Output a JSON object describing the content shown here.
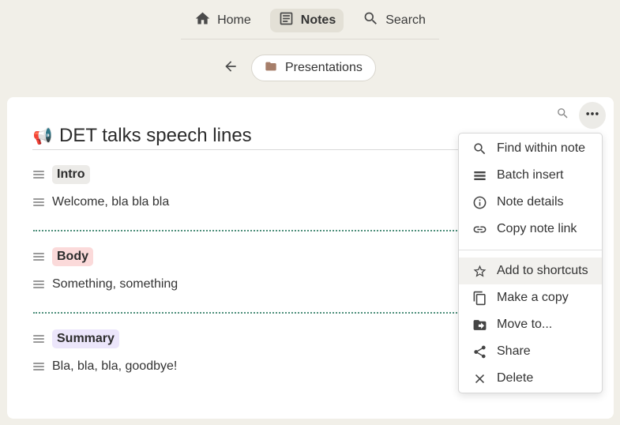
{
  "nav": {
    "home_label": "Home",
    "notes_label": "Notes",
    "search_label": "Search"
  },
  "breadcrumb": {
    "folder_label": "Presentations"
  },
  "note": {
    "title_emoji": "📢",
    "title": "DET talks speech lines",
    "sections": [
      {
        "tag": "Intro",
        "text": "Welcome, bla bla bla"
      },
      {
        "tag": "Body",
        "text": "Something, something"
      },
      {
        "tag": "Summary",
        "text": "Bla, bla, bla, goodbye!"
      }
    ]
  },
  "menu": {
    "items": [
      {
        "label": "Find within note",
        "icon": "search-icon"
      },
      {
        "label": "Batch insert",
        "icon": "batch-insert-icon"
      },
      {
        "label": "Note details",
        "icon": "info-icon"
      },
      {
        "label": "Copy note link",
        "icon": "link-icon"
      },
      {
        "label": "Add to shortcuts",
        "icon": "star-icon"
      },
      {
        "label": "Make a copy",
        "icon": "copy-icon"
      },
      {
        "label": "Move to...",
        "icon": "move-folder-icon"
      },
      {
        "label": "Share",
        "icon": "share-icon"
      },
      {
        "label": "Delete",
        "icon": "close-icon"
      }
    ]
  },
  "colors": {
    "background": "#f1efe8",
    "tag_body": "#fbdada",
    "tag_summary": "#ece6fb",
    "divider": "#4e8f7b"
  }
}
